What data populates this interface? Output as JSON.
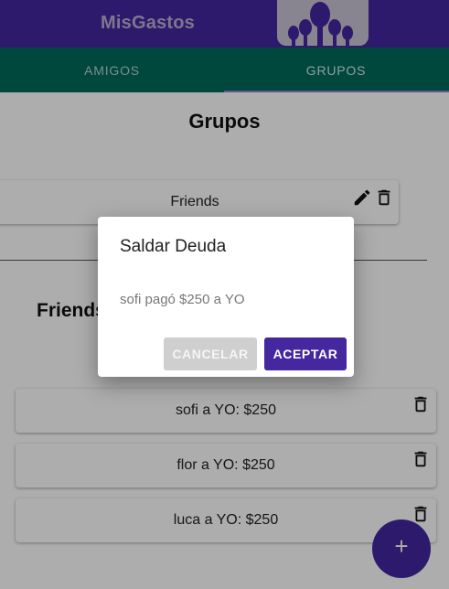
{
  "app": {
    "title": "MisGastos",
    "logo_icon": "people-group-icon"
  },
  "tabs": [
    {
      "label": "AMIGOS",
      "selected": false
    },
    {
      "label": "GRUPOS",
      "selected": true
    }
  ],
  "main": {
    "title": "Grupos",
    "groups": [
      {
        "name": "Friends",
        "edit_icon": "pencil-icon",
        "delete_icon": "trash-icon"
      }
    ],
    "section_subtitle": "Friends",
    "debts": [
      {
        "text": "sofi a YO: $250",
        "delete_icon": "trash-icon"
      },
      {
        "text": "flor a YO: $250",
        "delete_icon": "trash-icon"
      },
      {
        "text": "luca a YO: $250",
        "delete_icon": "trash-icon"
      }
    ],
    "fab_label": "+"
  },
  "dialog": {
    "title": "Saldar Deuda",
    "message": "sofi pagó $250 a YO",
    "cancel_label": "CANCELAR",
    "accept_label": "ACEPTAR"
  },
  "colors": {
    "primary": "#4527a0",
    "tabs_bg": "#00695c",
    "cancel_bg": "#cfcfcf"
  }
}
